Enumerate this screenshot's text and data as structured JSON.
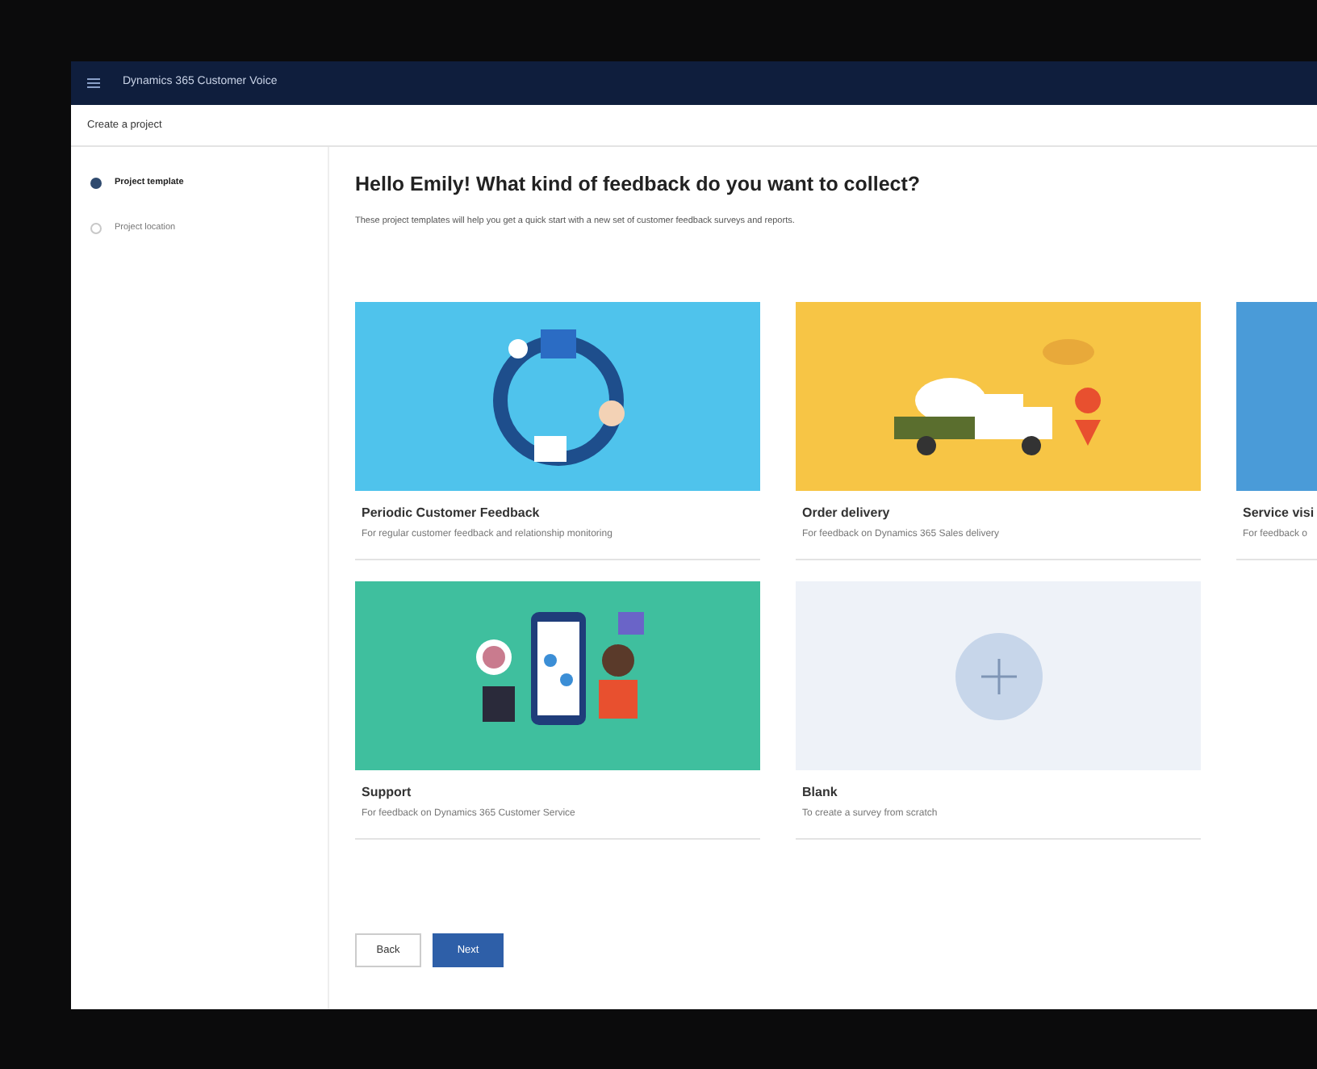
{
  "app": {
    "title": "Dynamics 365 Customer Voice"
  },
  "page_title": "Create a project",
  "steps": [
    {
      "label": "Project template",
      "selected": true
    },
    {
      "label": "Project location",
      "selected": false
    }
  ],
  "heading": "Hello Emily! What kind of feedback do you want to collect?",
  "subtitle": "These project templates will help you get a quick start with a new set of customer feedback surveys and reports.",
  "templates": [
    {
      "kind": "cycle",
      "color": "#4fc3ec",
      "title": "Periodic Customer Feedback",
      "description": "For regular customer feedback and relationship monitoring"
    },
    {
      "kind": "truck",
      "color": "#f7c545",
      "title": "Order delivery",
      "description": "For feedback on Dynamics 365 Sales delivery"
    },
    {
      "kind": "plain",
      "color": "#4a9bd8",
      "title": "Service visi",
      "description": "For feedback o"
    },
    {
      "kind": "phone",
      "color": "#3fbf9e",
      "title": "Support",
      "description": "For feedback on Dynamics 365 Customer Service"
    },
    {
      "kind": "blank",
      "color": "#eef2f8",
      "title": "Blank",
      "description": "To create a survey from scratch"
    }
  ],
  "buttons": [
    {
      "label": "Back",
      "kind": "secondary"
    },
    {
      "label": "Next",
      "kind": "primary"
    }
  ]
}
